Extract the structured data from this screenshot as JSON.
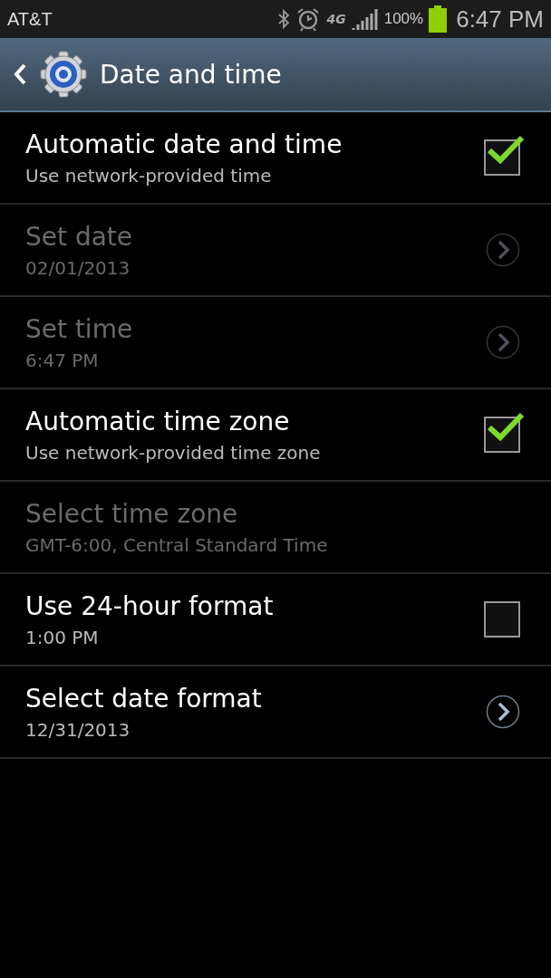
{
  "status_bar": {
    "carrier": "AT&T",
    "battery_percent": "100%",
    "time": "6:47 PM",
    "network": "4G"
  },
  "header": {
    "title": "Date and time"
  },
  "settings": [
    {
      "kind": "checkbox",
      "title": "Automatic date and time",
      "summary": "Use network-provided time",
      "disabled": false,
      "checked": true
    },
    {
      "kind": "link",
      "title": "Set date",
      "summary": "02/01/2013",
      "disabled": true
    },
    {
      "kind": "link",
      "title": "Set time",
      "summary": "6:47 PM",
      "disabled": true
    },
    {
      "kind": "checkbox",
      "title": "Automatic time zone",
      "summary": "Use network-provided time zone",
      "disabled": false,
      "checked": true
    },
    {
      "kind": "plain",
      "title": "Select time zone",
      "summary": "GMT-6:00, Central Standard Time",
      "disabled": true
    },
    {
      "kind": "checkbox",
      "title": "Use 24-hour format",
      "summary": "1:00 PM",
      "disabled": false,
      "checked": false
    },
    {
      "kind": "link",
      "title": "Select date format",
      "summary": "12/31/2013",
      "disabled": false
    }
  ]
}
